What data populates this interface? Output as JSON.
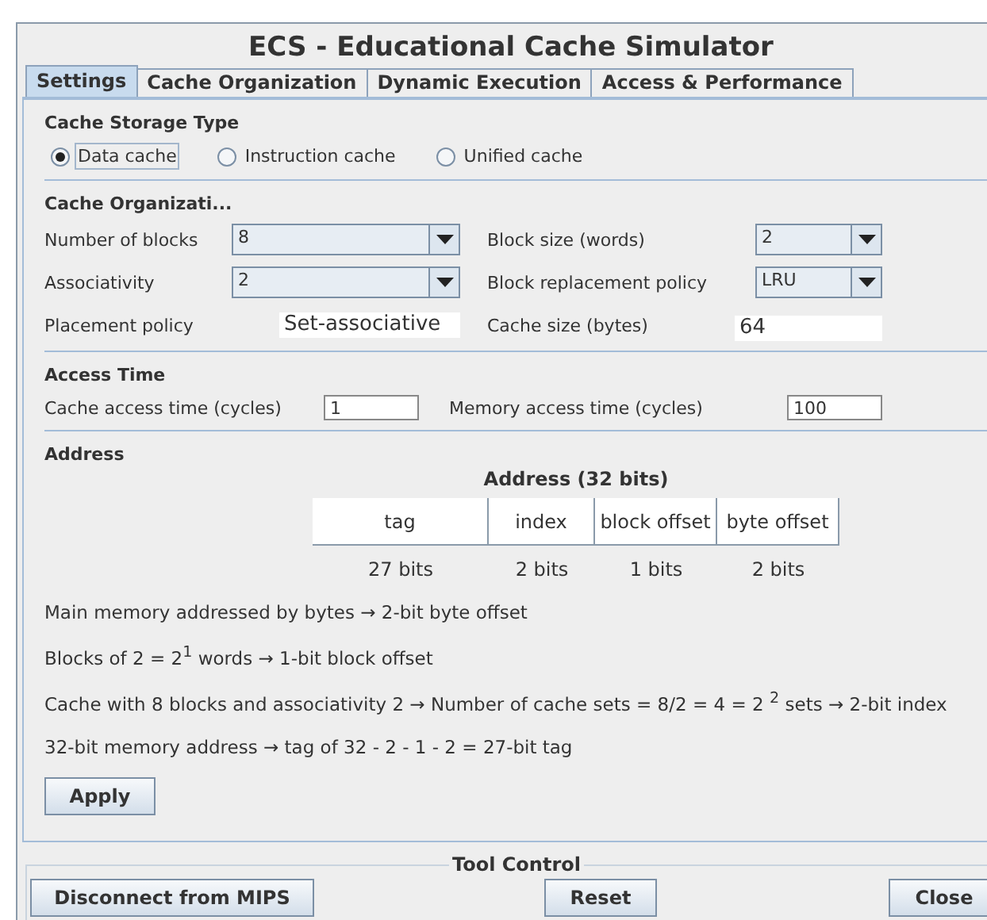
{
  "window": {
    "title": "ECS - Educational Cache Simulator"
  },
  "tabs": [
    {
      "label": "Settings",
      "selected": true
    },
    {
      "label": "Cache Organization",
      "selected": false
    },
    {
      "label": "Dynamic Execution",
      "selected": false
    },
    {
      "label": "Access & Performance",
      "selected": false
    }
  ],
  "storage": {
    "heading": "Cache Storage Type",
    "options": [
      {
        "label": "Data cache",
        "selected": true,
        "focused": true
      },
      {
        "label": "Instruction cache",
        "selected": false,
        "focused": false
      },
      {
        "label": "Unified cache",
        "selected": false,
        "focused": false
      }
    ]
  },
  "organization": {
    "heading": "Cache Organizati...",
    "fields": [
      {
        "label": "Number of blocks",
        "value": "8",
        "kind": "combo"
      },
      {
        "label": "Block size (words)",
        "value": "2",
        "kind": "combo"
      },
      {
        "label": "Associativity",
        "value": "2",
        "kind": "combo"
      },
      {
        "label": "Block replacement policy",
        "value": "LRU",
        "kind": "combo"
      },
      {
        "label": "Placement policy",
        "value": "Set-associative",
        "kind": "readout"
      },
      {
        "label": "Cache size (bytes)",
        "value": "64",
        "kind": "readout"
      }
    ]
  },
  "access": {
    "heading": "Access Time",
    "fields": [
      {
        "label": "Cache access time (cycles)",
        "value": "1"
      },
      {
        "label": "Memory access time (cycles)",
        "value": "100"
      }
    ]
  },
  "address": {
    "heading": "Address",
    "table_title": "Address (32 bits)",
    "columns": [
      {
        "name": "tag",
        "bits": "27 bits"
      },
      {
        "name": "index",
        "bits": "2 bits"
      },
      {
        "name": "block offset",
        "bits": "1 bits"
      },
      {
        "name": "byte offset",
        "bits": "2 bits"
      }
    ],
    "notes": [
      "Main memory addressed by bytes → 2-bit byte offset",
      "Blocks of 2 = 2$^{1}$ words → 1-bit block offset",
      "Cache with 8 blocks and associativity 2 → Number of cache sets = 8/2 = 4 = 2 $^{2}$ sets → 2-bit index",
      "32-bit memory address → tag of 32 - 2 - 1 - 2 = 27-bit tag"
    ]
  },
  "apply_button": "Apply",
  "tool_control": {
    "title": "Tool Control",
    "buttons": [
      "Disconnect from MIPS",
      "Reset",
      "Close"
    ]
  }
}
